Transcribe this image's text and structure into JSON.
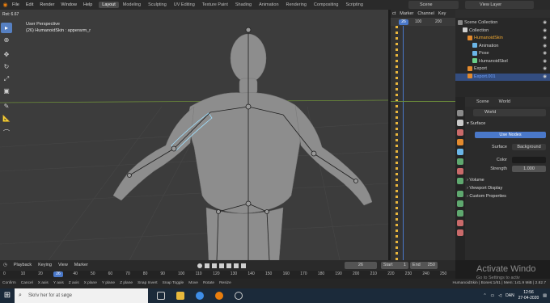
{
  "topbar": {
    "menus": [
      "File",
      "Edit",
      "Render",
      "Window",
      "Help"
    ],
    "workspaces": [
      "Layout",
      "Modeling",
      "Sculpting",
      "UV Editing",
      "Texture Paint",
      "Shading",
      "Animation",
      "Rendering",
      "Compositing",
      "Scripting"
    ],
    "active_workspace": "Layout",
    "scene": "Scene",
    "view_layer": "View Layer"
  },
  "viewport": {
    "rot_label": "Rot: 6.67",
    "view_name": "User Perspective",
    "object_info": "(26) HumanoidSkin : apperarm_r"
  },
  "timeline_panel": {
    "tabs": [
      "ct",
      "Marker",
      "Channel",
      "Key"
    ],
    "ruler": [
      "26",
      "100",
      "200"
    ],
    "current_frame": "26"
  },
  "outliner": {
    "rows": [
      {
        "label": "Scene Collection",
        "indent": 0,
        "color": "#d0d0d0",
        "icon": "#8a8a8a",
        "selected": false
      },
      {
        "label": "Collection",
        "indent": 1,
        "color": "#d0d0d0",
        "icon": "#cfcfcf",
        "selected": false
      },
      {
        "label": "HumanoidSkin",
        "indent": 2,
        "color": "#f0a830",
        "icon": "#e38a2e",
        "selected": false
      },
      {
        "label": "Animation",
        "indent": 3,
        "color": "#d0d0d0",
        "icon": "#6bb6e8",
        "selected": false
      },
      {
        "label": "Pose",
        "indent": 3,
        "color": "#d0d0d0",
        "icon": "#6bb6e8",
        "selected": false
      },
      {
        "label": "HumanoidSkel",
        "indent": 3,
        "color": "#d0d0d0",
        "icon": "#6bd08a",
        "selected": false
      },
      {
        "label": "Export",
        "indent": 2,
        "color": "#d0d0d0",
        "icon": "#e38a2e",
        "selected": false
      },
      {
        "label": "Export.001",
        "indent": 2,
        "color": "#6fa3ff",
        "icon": "#e38a2e",
        "selected": true
      }
    ]
  },
  "properties": {
    "tabs": [
      "Scene",
      "World"
    ],
    "world_name": "World",
    "surface_section": "Surface",
    "use_nodes_label": "Use Nodes",
    "surface_label": "Surface",
    "surface_value": "Background",
    "color_label": "Color",
    "strength_label": "Strength",
    "strength_value": "1.000",
    "sections": [
      "Volume",
      "Viewport Display",
      "Custom Properties"
    ]
  },
  "playback": {
    "menus": [
      "Playback",
      "Keying",
      "View",
      "Marker"
    ],
    "current_frame": "26",
    "start_label": "Start",
    "start_value": "1",
    "end_label": "End",
    "end_value": "250"
  },
  "frame_ruler": [
    "0",
    "10",
    "20",
    "26",
    "40",
    "50",
    "60",
    "70",
    "80",
    "90",
    "100",
    "110",
    "120",
    "130",
    "140",
    "150",
    "160",
    "170",
    "180",
    "190",
    "200",
    "210",
    "220",
    "230",
    "240",
    "250"
  ],
  "statusbar": {
    "items": [
      "Confirm",
      "Cancel",
      "X axis",
      "Y axis",
      "Z axis",
      "X plane",
      "Y plane",
      "Z plane",
      "Snap Invert",
      "Snap Toggle",
      "Move",
      "Rotate",
      "Resize"
    ],
    "info": "HumanoidSkin | Bones:1/61 | Mem: 141.9 MiB | 2.82.7"
  },
  "overlay": {
    "activate_title": "Activate Windo",
    "activate_sub": "Go to Settings to activ"
  },
  "taskbar": {
    "search_placeholder": "Skriv her for at søge",
    "lang": "DAN",
    "time": "12:56",
    "date": "27-04-2020"
  }
}
